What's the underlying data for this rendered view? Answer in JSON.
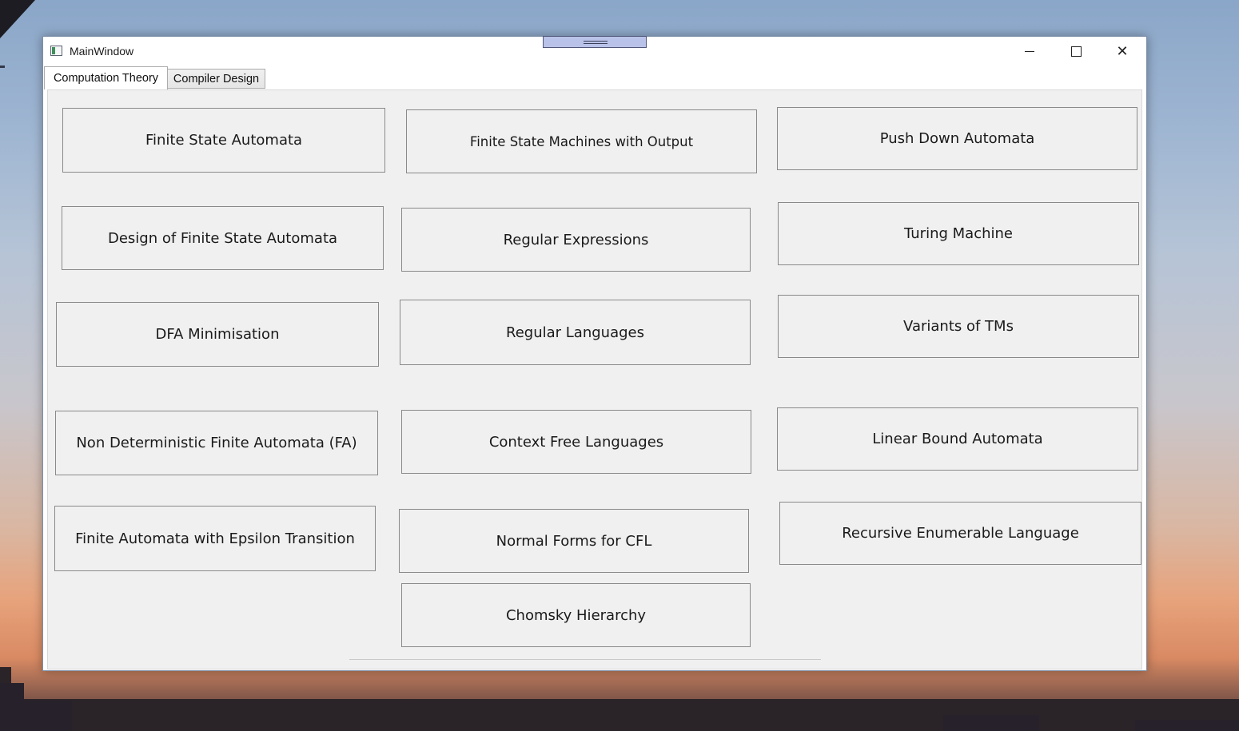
{
  "window": {
    "title": "MainWindow"
  },
  "tabs": [
    {
      "label": "Computation Theory",
      "selected": true
    },
    {
      "label": "Compiler Design",
      "selected": false
    }
  ],
  "buttons": {
    "finite_state_automata": "Finite State Automata",
    "fsm_with_output": "Finite State Machines with Output",
    "push_down_automata": "Push Down Automata",
    "design_fsa": "Design of Finite State Automata",
    "regular_expressions": "Regular Expressions",
    "turing_machine": "Turing Machine",
    "dfa_minimisation": "DFA Minimisation",
    "regular_languages": "Regular Languages",
    "variants_of_tms": "Variants of TMs",
    "nfa": "Non Deterministic Finite Automata (FA)",
    "context_free_languages": "Context Free Languages",
    "linear_bound_automata": "Linear Bound Automata",
    "fa_epsilon": "Finite Automata with Epsilon Transition",
    "normal_forms_cfl": "Normal Forms for CFL",
    "recursive_enumerable": "Recursive Enumerable Language",
    "chomsky_hierarchy": "Chomsky Hierarchy"
  },
  "icons": {
    "app": "app-window-icon",
    "minimize": "minimize-icon",
    "maximize": "maximize-icon",
    "close": "close-icon"
  },
  "colors": {
    "content_bg": "#f0f0f0",
    "button_border": "#8a8a8a",
    "grip_fill": "#b9c2e8"
  }
}
